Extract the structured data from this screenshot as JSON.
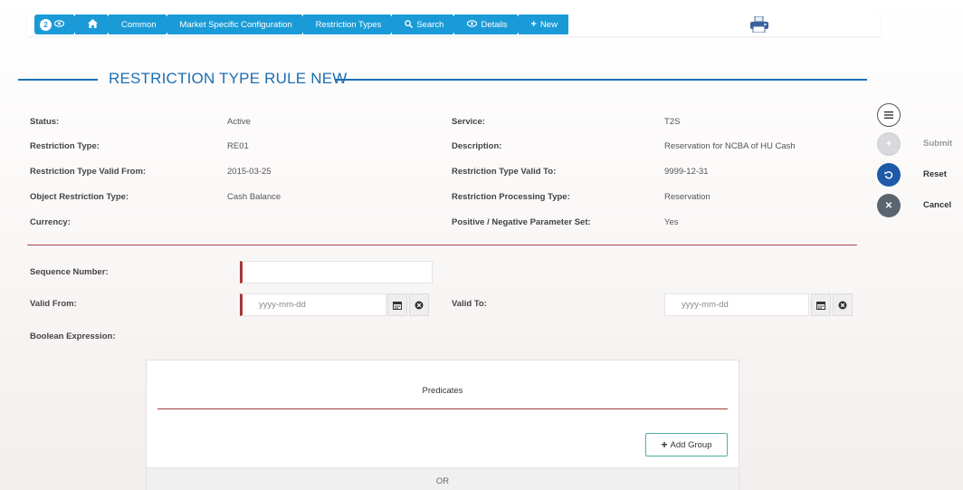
{
  "breadcrumb": {
    "badge_count": "2",
    "items": [
      "Common",
      "Market Specific Configuration",
      "Restriction Types",
      "Search",
      "Details",
      "New"
    ]
  },
  "title": "RESTRICTION TYPE RULE NEW",
  "details": {
    "status_label": "Status:",
    "status_value": "Active",
    "service_label": "Service:",
    "service_value": "T2S",
    "restriction_type_label": "Restriction Type:",
    "restriction_type_value": "RE01",
    "description_label": "Description:",
    "description_value": "Reservation for NCBA of HU Cash",
    "valid_from_label": "Restriction Type Valid From:",
    "valid_from_value": "2015-03-25",
    "valid_to_label": "Restriction Type Valid To:",
    "valid_to_value": "9999-12-31",
    "object_type_label": "Object Restriction Type:",
    "object_type_value": "Cash Balance",
    "processing_type_label": "Restriction Processing Type:",
    "processing_type_value": "Reservation",
    "currency_label": "Currency:",
    "currency_value": "",
    "pos_neg_label": "Positive / Negative Parameter Set:",
    "pos_neg_value": "Yes"
  },
  "form": {
    "sequence_label": "Sequence Number:",
    "sequence_value": "",
    "valid_from_label": "Valid From:",
    "valid_from_placeholder": "yyyy-mm-dd",
    "valid_to_label": "Valid To:",
    "valid_to_placeholder": "yyyy-mm-dd",
    "boolean_label": "Boolean Expression:"
  },
  "predicates": {
    "title": "Predicates",
    "add_group_label": "Add Group",
    "or_label": "OR"
  },
  "actions": {
    "submit_label": "Submit",
    "reset_label": "Reset",
    "cancel_label": "Cancel"
  },
  "colors": {
    "breadcrumb": "#1a9bd7",
    "title": "#1a6fb3",
    "required": "#a33a3a",
    "reset": "#1f5aa8",
    "cancel": "#5a6570"
  }
}
